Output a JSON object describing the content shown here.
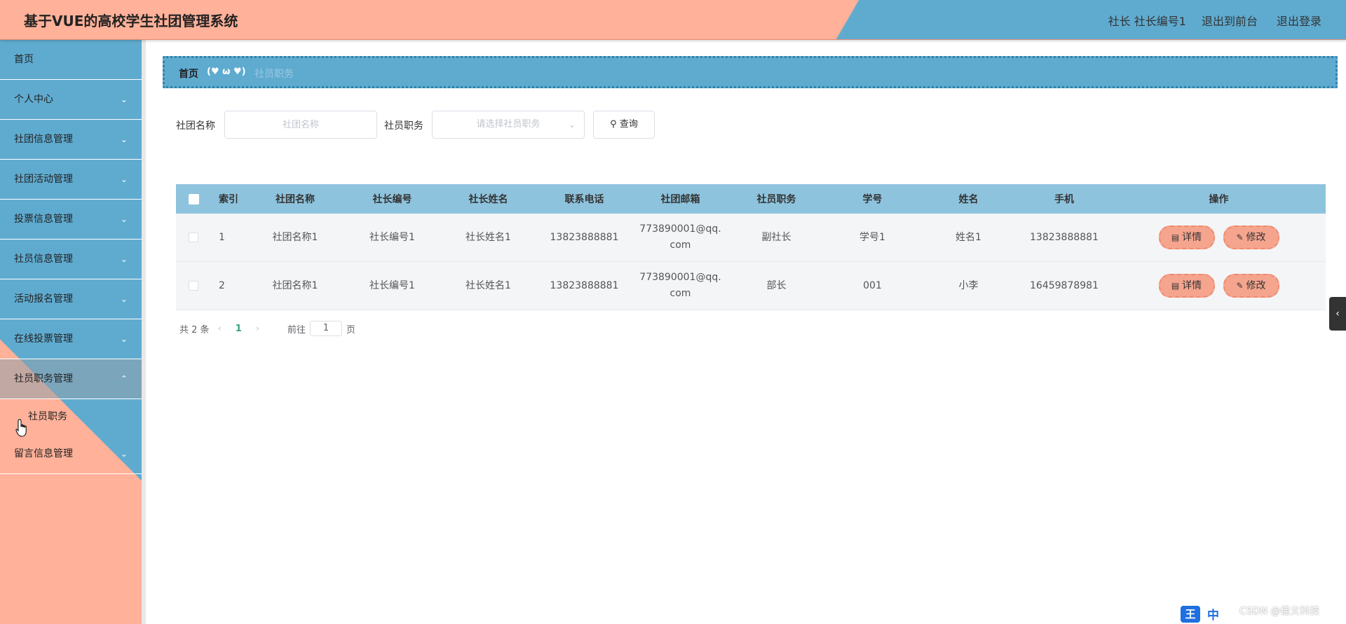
{
  "header": {
    "title": "基于VUE的高校学生社团管理系统",
    "user": "社长 社长编号1",
    "to_front": "退出到前台",
    "logout": "退出登录"
  },
  "sidebar": {
    "items": [
      {
        "label": "首页"
      },
      {
        "label": "个人中心"
      },
      {
        "label": "社团信息管理"
      },
      {
        "label": "社团活动管理"
      },
      {
        "label": "投票信息管理"
      },
      {
        "label": "社员信息管理"
      },
      {
        "label": "活动报名管理"
      },
      {
        "label": "在线投票管理"
      },
      {
        "label": "社员职务管理"
      },
      {
        "label": "留言信息管理"
      }
    ],
    "sub_item": "社员职务"
  },
  "breadcrumb": {
    "home": "首页",
    "face": "(♥ ω ♥)",
    "current": "社员职务"
  },
  "search": {
    "club_label": "社团名称",
    "club_placeholder": "社团名称",
    "position_label": "社员职务",
    "position_placeholder": "请选择社员职务",
    "button": "查询"
  },
  "table": {
    "headers": [
      "索引",
      "社团名称",
      "社长编号",
      "社长姓名",
      "联系电话",
      "社团邮箱",
      "社员职务",
      "学号",
      "姓名",
      "手机",
      "操作"
    ],
    "rows": [
      {
        "index": "1",
        "club": "社团名称1",
        "leader_no": "社长编号1",
        "leader_name": "社长姓名1",
        "phone": "13823888881",
        "email_1": "773890001@qq.",
        "email_2": "com",
        "position": "副社长",
        "student_no": "学号1",
        "name": "姓名1",
        "mobile": "13823888881"
      },
      {
        "index": "2",
        "club": "社团名称1",
        "leader_no": "社长编号1",
        "leader_name": "社长姓名1",
        "phone": "13823888881",
        "email_1": "773890001@qq.",
        "email_2": "com",
        "position": "部长",
        "student_no": "001",
        "name": "小李",
        "mobile": "16459878981"
      }
    ],
    "detail_label": "详情",
    "edit_label": "修改"
  },
  "pager": {
    "total": "共 2 条",
    "current_page": "1",
    "goto_label": "前往",
    "goto_value": "1",
    "page_unit": "页"
  },
  "overlay": {
    "ime": "王",
    "ime_mode": "中",
    "watermark": "CSDN @佳义科技"
  },
  "colors": {
    "salmon": "#ffb199",
    "blue": "#5fabd0",
    "table_header": "#8ec3dd",
    "op_button": "#f5a48e"
  }
}
